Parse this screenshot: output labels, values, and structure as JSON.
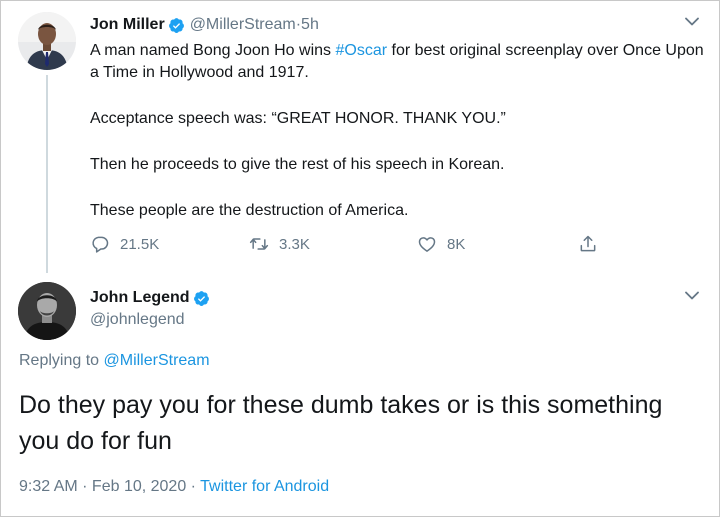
{
  "colors": {
    "link": "#1b95e0",
    "secondary_text": "#657786",
    "primary_text": "#14171a",
    "verified_badge": "#1da1f2",
    "thread_line": "#cfd9de"
  },
  "tweet1": {
    "author_name": "Jon Miller",
    "handle": "@MillerStream",
    "separator": " · ",
    "time": "5h",
    "verified_icon": "verified-badge-icon",
    "body_intro": "A man named Bong Joon Ho wins ",
    "hashtag": "#Oscar",
    "body_rest": " for best original screenplay over Once Upon a Time in Hollywood and 1917.",
    "paragraph2": "Acceptance speech was: “GREAT HONOR. THANK YOU.”",
    "paragraph3": "Then he proceeds to give the rest of his speech in Korean.",
    "paragraph4": "These people are the destruction of America.",
    "replies": "21.5K",
    "retweets": "3.3K",
    "likes": "8K"
  },
  "tweet2": {
    "author_name": "John Legend",
    "handle": "@johnlegend",
    "verified_icon": "verified-badge-icon",
    "replying_prefix": "Replying to ",
    "replying_to": "@MillerStream",
    "body": "Do they pay you for these dumb takes or is this something you do for fun",
    "time": "9:32 AM",
    "separator1": " · ",
    "date": "Feb 10, 2020",
    "separator2": " · ",
    "source": "Twitter for Android"
  }
}
